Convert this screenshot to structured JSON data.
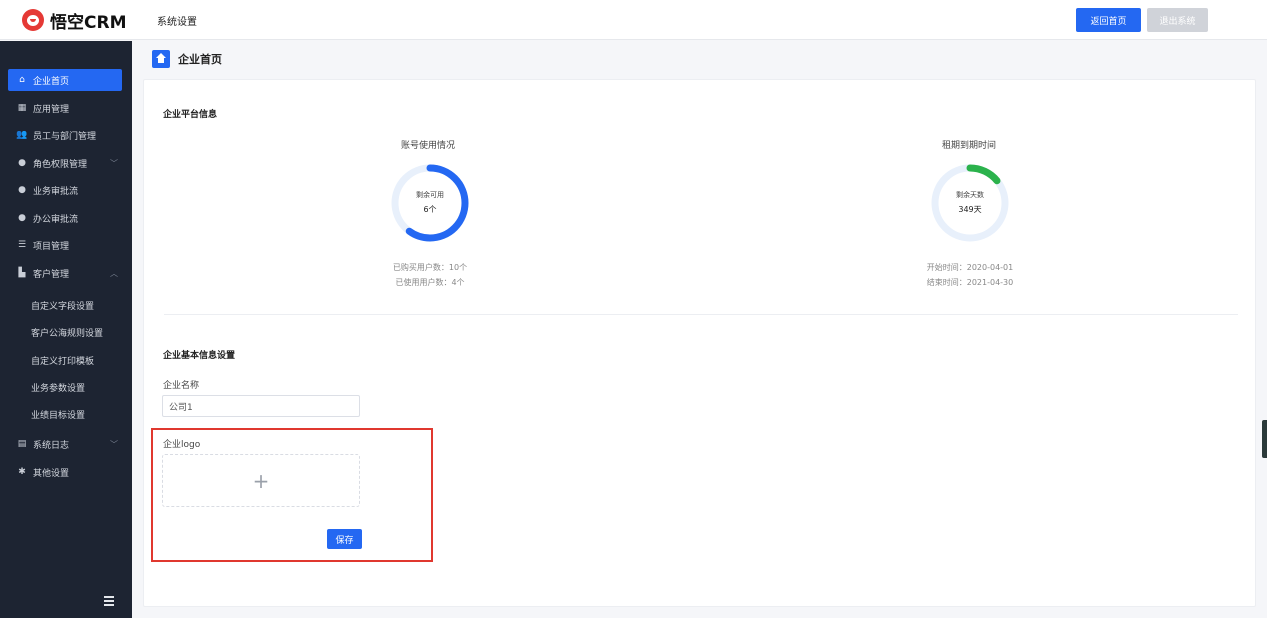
{
  "header": {
    "brand": "悟空CRM",
    "title": "系统设置",
    "home_button": "返回首页",
    "exit_button": "退出系统"
  },
  "sidebar": {
    "items": [
      {
        "label": "企业首页",
        "icon": "home-icon"
      },
      {
        "label": "应用管理",
        "icon": "apps-icon"
      },
      {
        "label": "员工与部门管理",
        "icon": "users-icon"
      },
      {
        "label": "角色权限管理",
        "icon": "user-icon"
      },
      {
        "label": "业务审批流",
        "icon": "user-icon"
      },
      {
        "label": "办公审批流",
        "icon": "user-icon"
      },
      {
        "label": "项目管理",
        "icon": "list-icon"
      },
      {
        "label": "客户管理",
        "icon": "building-icon"
      }
    ],
    "customer_sub": [
      "自定义字段设置",
      "客户公海规则设置",
      "自定义打印模板",
      "业务参数设置",
      "业绩目标设置"
    ],
    "bottom_items": [
      {
        "label": "系统日志",
        "icon": "log-icon"
      },
      {
        "label": "其他设置",
        "icon": "gear-icon"
      }
    ]
  },
  "breadcrumb": {
    "label": "企业首页"
  },
  "platform": {
    "section_title": "企业平台信息",
    "accounts": {
      "title": "账号使用情况",
      "center_label": "剩余可用",
      "center_value": "6个",
      "purchased": "已购买用户数：10个",
      "used": "已使用用户数：4个",
      "fraction_remaining": 0.6,
      "color": "#2468f2"
    },
    "lease": {
      "title": "租期到期时间",
      "center_label": "剩余天数",
      "center_value": "349天",
      "start": "开始时间：2020-04-01",
      "end": "结束时间：2021-04-30",
      "fraction_remaining": 0.14,
      "color": "#2bb24c"
    }
  },
  "basic": {
    "section_title": "企业基本信息设置",
    "name_label": "企业名称",
    "name_value": "公司1",
    "logo_label": "企业logo",
    "save_button": "保存"
  }
}
